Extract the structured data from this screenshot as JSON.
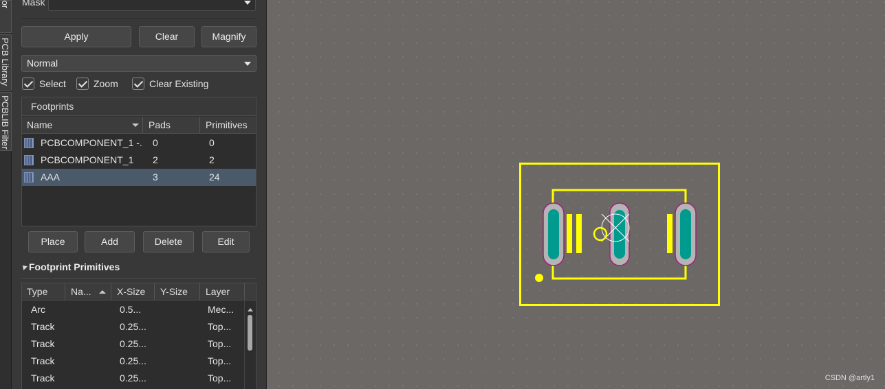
{
  "side_tabs": [
    "vigator",
    "PCB Library",
    "PCBLIB Filter"
  ],
  "mask": {
    "label": "Mask",
    "value": ""
  },
  "actions": {
    "apply": "Apply",
    "clear": "Clear",
    "magnify": "Magnify"
  },
  "mode": {
    "selected": "Normal"
  },
  "options": {
    "select": {
      "label": "Select",
      "checked": true
    },
    "zoom": {
      "label": "Zoom",
      "checked": true
    },
    "clear_existing": {
      "label": "Clear Existing",
      "checked": true
    }
  },
  "footprints": {
    "title": "Footprints",
    "columns": [
      "Name",
      "Pads",
      "Primitives"
    ],
    "rows": [
      {
        "name": "PCBCOMPONENT_1 -...",
        "pads": "0",
        "primitives": "0",
        "selected": false
      },
      {
        "name": "PCBCOMPONENT_1",
        "pads": "2",
        "primitives": "2",
        "selected": false
      },
      {
        "name": "AAA",
        "pads": "3",
        "primitives": "24",
        "selected": true
      }
    ],
    "buttons": {
      "place": "Place",
      "add": "Add",
      "delete": "Delete",
      "edit": "Edit"
    }
  },
  "primitives": {
    "title": "Footprint Primitives",
    "columns": [
      "Type",
      "Na...",
      "X-Size",
      "Y-Size",
      "Layer"
    ],
    "rows": [
      {
        "type": "Arc",
        "name": "",
        "x_size": "0.5...",
        "y_size": "",
        "layer": "Mec..."
      },
      {
        "type": "Track",
        "name": "",
        "x_size": "0.25...",
        "y_size": "",
        "layer": "Top..."
      },
      {
        "type": "Track",
        "name": "",
        "x_size": "0.25...",
        "y_size": "",
        "layer": "Top..."
      },
      {
        "type": "Track",
        "name": "",
        "x_size": "0.25...",
        "y_size": "",
        "layer": "Top..."
      },
      {
        "type": "Track",
        "name": "",
        "x_size": "0.25...",
        "y_size": "",
        "layer": "Top..."
      }
    ]
  },
  "canvas": {
    "colors": {
      "background": "#6b6866",
      "silkscreen": "#ffff00",
      "pad_copper": "#009a8f",
      "pad_ring": "#b4b4b4",
      "pad_outline": "#a0207a",
      "origin": "#ffffff"
    }
  },
  "watermark": "CSDN @artly1"
}
